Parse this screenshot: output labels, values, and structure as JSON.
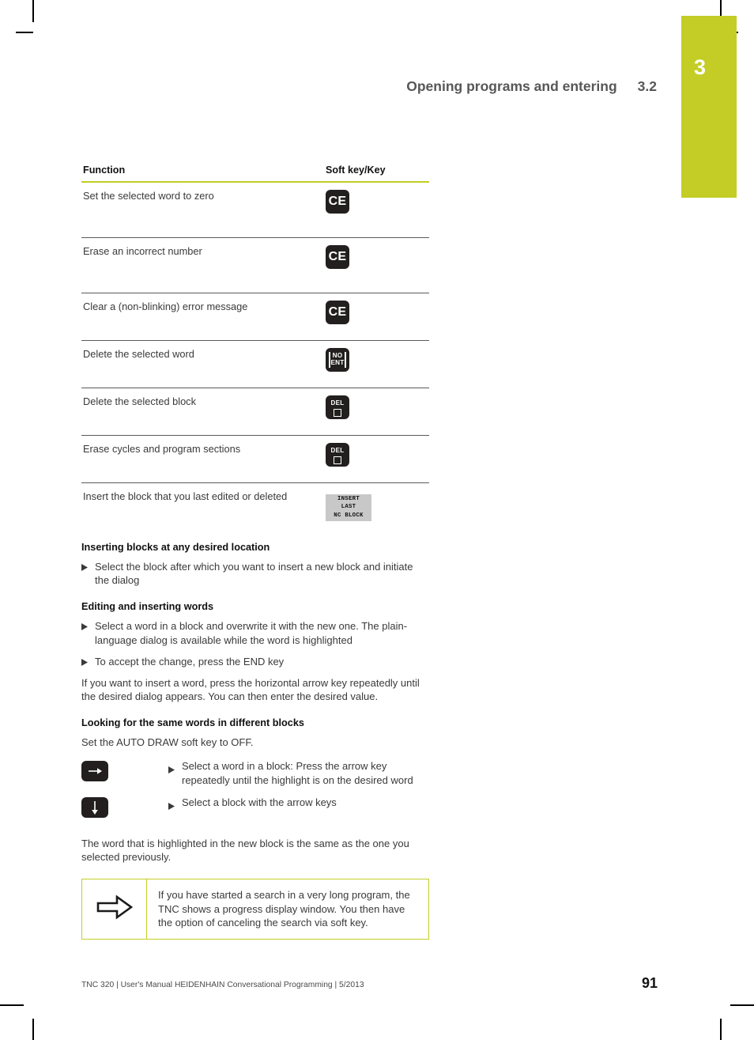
{
  "chapter_tab": {
    "number": "3",
    "color": "#c3cd26"
  },
  "header": {
    "title": "Opening programs and entering",
    "section": "3.2"
  },
  "table": {
    "columns": [
      "Function",
      "Soft key/Key"
    ],
    "rows": [
      {
        "function": "Set the selected word to zero",
        "key_type": "ce",
        "key_label": "CE"
      },
      {
        "function": "Erase an incorrect number",
        "key_type": "ce",
        "key_label": "CE"
      },
      {
        "function": "Clear a (non-blinking) error message",
        "key_type": "ce",
        "key_label": "CE"
      },
      {
        "function": "Delete the selected word",
        "key_type": "noent",
        "key_line1": "NO",
        "key_line2": "ENT"
      },
      {
        "function": "Delete the selected block",
        "key_type": "del",
        "key_label": "DEL"
      },
      {
        "function": "Erase cycles and program sections",
        "key_type": "del",
        "key_label": "DEL"
      },
      {
        "function": "Insert the block that you last edited or deleted",
        "key_type": "softkey",
        "key_line1": "INSERT",
        "key_line2": "LAST",
        "key_line3": "NC BLOCK"
      }
    ]
  },
  "sections": {
    "inserting": {
      "heading": "Inserting blocks at any desired location",
      "bullet1": "Select the block after which you want to insert a new block and initiate the dialog"
    },
    "editing": {
      "heading": "Editing and inserting words",
      "bullet1": "Select a word in a block and overwrite it with the new one. The plain-language dialog is available while the word is highlighted",
      "bullet2": "To accept the change, press the END key",
      "paragraph": "If you want to insert a word, press the horizontal arrow key repeatedly until the desired dialog appears. You can then enter the desired value."
    },
    "looking": {
      "heading": "Looking for the same words in different blocks",
      "intro": "Set the AUTO DRAW soft key to OFF.",
      "step1": "Select a word in a block: Press the arrow key repeatedly until the highlight is on the desired word",
      "step2": "Select a block with the arrow keys",
      "outro": "The word that is highlighted in the new block is the same as the one you selected previously."
    }
  },
  "note": {
    "text": "If you have started a search in a very long program, the TNC shows a progress display window. You then have the option of canceling the search via soft key.",
    "border_color": "#c3cd26"
  },
  "footer": {
    "text": "TNC 320 | User's Manual HEIDENHAIN Conversational Programming | 5/2013",
    "page_number": "91"
  }
}
